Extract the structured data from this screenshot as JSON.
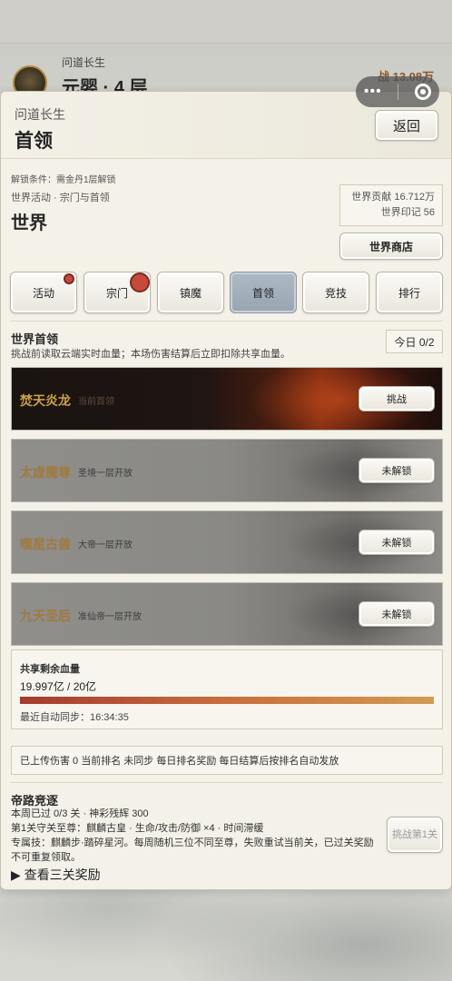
{
  "background": {
    "player_name": "问道长生",
    "realm": "元婴 · 4 层",
    "power": "战 13.08万"
  },
  "header": {
    "subtitle": "问道长生",
    "title": "首领",
    "back_label": "返回"
  },
  "world": {
    "unlock_condition": "解锁条件：需金丹1层解锁",
    "breadcrumb": "世界活动 · 宗门与首领",
    "title": "世界",
    "contribution": "世界贡献 16.712万",
    "seal": "世界印记 56",
    "shop_label": "世界商店"
  },
  "tabs": [
    {
      "label": "活动",
      "active": false,
      "badge": "small"
    },
    {
      "label": "宗门",
      "active": false,
      "badge": "big"
    },
    {
      "label": "镇魔",
      "active": false
    },
    {
      "label": "首领",
      "active": true
    },
    {
      "label": "竞技",
      "active": false
    },
    {
      "label": "排行",
      "active": false
    }
  ],
  "world_boss": {
    "heading": "世界首领",
    "description": "挑战前读取云端实时血量；本场伤害结算后立即扣除共享血量。",
    "today": "今日 0/2",
    "bosses": [
      {
        "name": "焚天炎龙",
        "note": "当前首领",
        "button": "挑战",
        "locked": false
      },
      {
        "name": "太虚魔尊",
        "note": "圣境一层开放",
        "button": "未解锁",
        "locked": true
      },
      {
        "name": "噬星古兽",
        "note": "大帝一层开放",
        "button": "未解锁",
        "locked": true
      },
      {
        "name": "九天圣后",
        "note": "准仙帝一层开放",
        "button": "未解锁",
        "locked": true
      }
    ]
  },
  "shared_hp": {
    "label": "共享剩余血量",
    "value": "19.997亿 / 20亿",
    "fraction": 0.99985,
    "last_sync": "最近自动同步：16:34:35"
  },
  "status": {
    "text": "已上传伤害 0   当前排名 未同步   每日排名奖励 每日结算后按排名自动发放"
  },
  "emperor_road": {
    "title": "帝路竞逐",
    "line1": "本周已过 0/3 关 · 神彩残辉 300",
    "line2": "第1关守关至尊：麒麟古皇 · 生命/攻击/防御 ×4 · 时间滞缓",
    "line3": "专属技：麒麟步·踏碎星河。每周随机三位不同至尊，失败重试当前关，已过关奖励不可重复领取。",
    "challenge_label": "挑战第1关",
    "reward_link": "▶ 查看三关奖励"
  }
}
